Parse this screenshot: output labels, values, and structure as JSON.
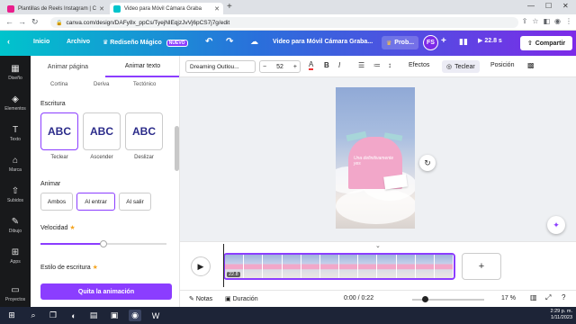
{
  "browser": {
    "tabs": [
      {
        "title": "Plantillas de Reels Instagram | C",
        "active": false,
        "icon_color": "#e91e8c"
      },
      {
        "title": "Video para Móvil Cámara Graba",
        "active": true,
        "icon_color": "#00c4cc"
      }
    ],
    "url": "canva.com/design/DAFy8x_ppCs/TyejNlEqjzJvVj6pCS7j7g/edit"
  },
  "header": {
    "inicio": "Inicio",
    "archivo": "Archivo",
    "magic": "Rediseño Mágico",
    "new_badge": "NUEVO",
    "doc_title": "Video para Móvil Cámara Graba...",
    "pro": "Prob...",
    "avatar": "FS",
    "duration": "22.8 s",
    "share": "Compartir"
  },
  "rail": [
    {
      "label": "Diseño",
      "icon": "layout-icon"
    },
    {
      "label": "Elementos",
      "icon": "elements-icon"
    },
    {
      "label": "Texto",
      "icon": "text-icon"
    },
    {
      "label": "Marca",
      "icon": "brand-icon"
    },
    {
      "label": "Subidos",
      "icon": "upload-icon"
    },
    {
      "label": "Dibujo",
      "icon": "draw-icon"
    },
    {
      "label": "Apps",
      "icon": "apps-icon"
    },
    {
      "label": "Proyectos",
      "icon": "folder-icon"
    }
  ],
  "panel": {
    "tab_page": "Animar página",
    "tab_text": "Animar texto",
    "cut_labels": [
      "Cortina",
      "Deriva",
      "Tectónico"
    ],
    "section_writing": "Escritura",
    "tiles": [
      {
        "sample": "ABC",
        "label": "Teclear"
      },
      {
        "sample": "ABC",
        "label": "Ascender"
      },
      {
        "sample": "ABC",
        "label": "Deslizar"
      }
    ],
    "section_animate": "Animar",
    "animate_options": [
      "Ambos",
      "Al entrar",
      "Al salir"
    ],
    "speed_label": "Velocidad",
    "speed_value": 0.5,
    "writing_style_label": "Estilo de escritura",
    "remove_button": "Quita la animación"
  },
  "toolbar": {
    "font": "Dreaming Outlou...",
    "font_size": "52",
    "minus": "−",
    "plus": "+",
    "bold": "B",
    "italic": "I",
    "effects": "Efectos",
    "teclear": "Teclear",
    "position": "Posición"
  },
  "canvas": {
    "card_text": "Una definitivamente yes"
  },
  "timeline": {
    "clip_duration": "22.8"
  },
  "bottom": {
    "notes": "Notas",
    "duration": "Duración",
    "time": "0:00 / 0:22",
    "zoom_value": 0.17,
    "zoom_text": "17 %"
  },
  "taskbar": {
    "time": "2:29 p. m.",
    "date": "1/11/2023"
  }
}
